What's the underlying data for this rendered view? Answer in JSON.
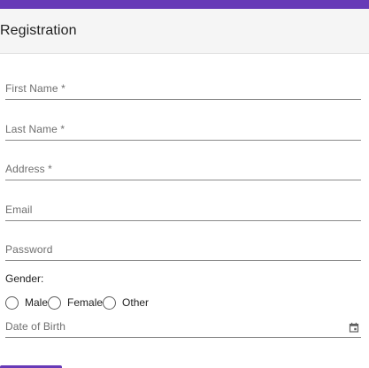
{
  "colors": {
    "accent": "#673ab7"
  },
  "header": {
    "title": "Registration"
  },
  "form": {
    "fields": [
      {
        "key": "first_name",
        "label": "First Name *",
        "value": ""
      },
      {
        "key": "last_name",
        "label": "Last Name *",
        "value": ""
      },
      {
        "key": "address",
        "label": "Address *",
        "value": ""
      },
      {
        "key": "email",
        "label": "Email",
        "value": ""
      },
      {
        "key": "password",
        "label": "Password",
        "value": ""
      }
    ],
    "gender": {
      "label": "Gender:",
      "options": [
        "Male",
        "Female",
        "Other"
      ]
    },
    "dob": {
      "label": "Date of Birth",
      "icon": "calendar-icon"
    }
  }
}
